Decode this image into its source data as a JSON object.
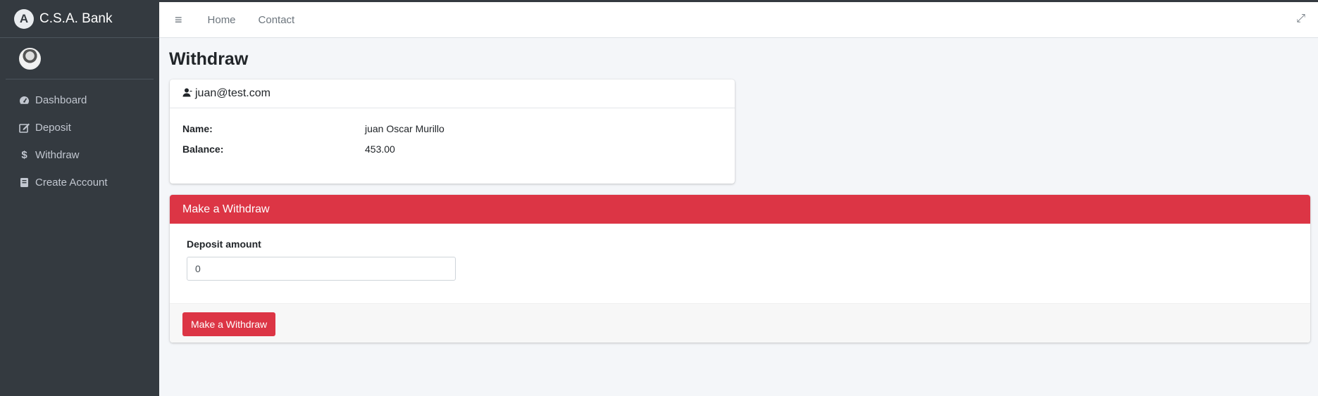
{
  "brand": {
    "logo_letter": "A",
    "name": "C.S.A. Bank"
  },
  "sidebar": {
    "items": [
      {
        "label": "Dashboard",
        "icon": "tachometer-icon"
      },
      {
        "label": "Deposit",
        "icon": "edit-icon"
      },
      {
        "label": "Withdraw",
        "icon": "dollar-icon"
      },
      {
        "label": "Create Account",
        "icon": "book-icon"
      }
    ]
  },
  "topbar": {
    "menu_icon": "≡",
    "home_label": "Home",
    "contact_label": "Contact",
    "expand_icon": "⤢"
  },
  "page": {
    "title": "Withdraw"
  },
  "account": {
    "email": "juan@test.com",
    "name_label": "Name:",
    "name_value": "juan Oscar Murillo",
    "balance_label": "Balance:",
    "balance_value": "453.00"
  },
  "withdraw": {
    "header": "Make a Withdraw",
    "field_label": "Deposit amount",
    "amount_value": "0",
    "button_label": "Make a Withdraw"
  },
  "colors": {
    "accent": "#dc3545",
    "sidebar": "#343a40",
    "background": "#f4f6f9"
  }
}
